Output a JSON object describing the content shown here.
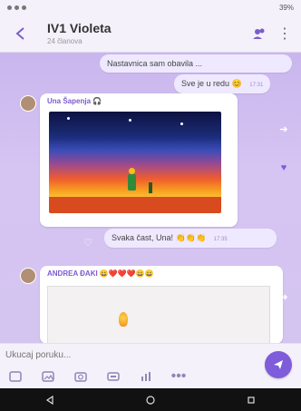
{
  "status_bar": {
    "left_icons": [
      "signal-icon",
      "image-icon",
      "settings-icon"
    ],
    "right_text": "39%"
  },
  "header": {
    "title": "IV1 Violeta",
    "subtitle": "24 članova",
    "actions": [
      "contacts-icon",
      "menu-dots-icon"
    ]
  },
  "messages": [
    {
      "type": "outgoing-text",
      "text": "Nastavnica sam obavila ...",
      "time": ""
    },
    {
      "type": "outgoing-text",
      "text": "Sve je u redu 😊",
      "time": "17:31"
    },
    {
      "type": "incoming-image",
      "sender": "Una Šapenja 🎧",
      "image_alt": "Painting at sunset"
    },
    {
      "type": "outgoing-text",
      "text": "Svaka čast, Una! 👏👏👏",
      "time": "17:35"
    },
    {
      "type": "incoming-image",
      "sender": "ANDREA ĐAKI 😀❤️❤️❤️😀😀",
      "image_alt": "Drawing"
    }
  ],
  "input": {
    "placeholder": "Ukucaj poruku...",
    "send_icon": "send-icon",
    "tools": [
      "emoji-icon",
      "gallery-icon",
      "camera-icon",
      "gif-icon",
      "poll-icon",
      "more-icon"
    ]
  },
  "navigation": {
    "items": [
      "back-nav-icon",
      "home-nav-icon",
      "recent-nav-icon"
    ]
  },
  "colors": {
    "accent": "#7e5cda",
    "background": "#d7c9ef",
    "bubble_out": "#efe9ff"
  }
}
